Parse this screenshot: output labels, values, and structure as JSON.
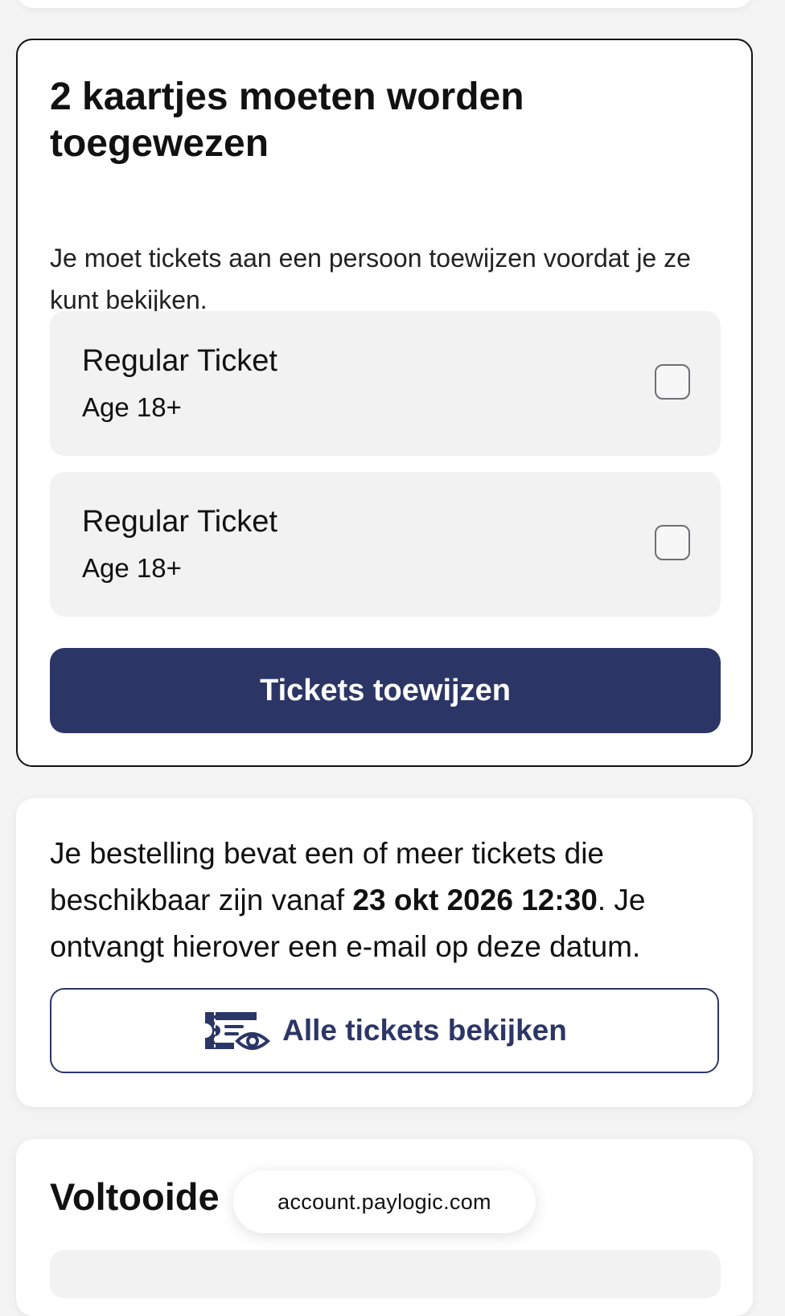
{
  "assign_card": {
    "title": "2 kaartjes moeten worden toegewezen",
    "description": "Je moet tickets aan een persoon toewijzen voordat je ze kunt bekijken.",
    "tickets": [
      {
        "name": "Regular Ticket",
        "age": "Age 18+",
        "checked": false
      },
      {
        "name": "Regular Ticket",
        "age": "Age 18+",
        "checked": false
      }
    ],
    "assign_button_label": "Tickets toewijzen"
  },
  "info_card": {
    "text_before": "Je bestelling bevat een of meer tickets die beschikbaar zijn vanaf ",
    "available_date": "23 okt 2026 12:30",
    "text_after": ". Je ontvangt hierover een e-mail op deze datum.",
    "view_button_label": "Alle tickets bekijken",
    "view_button_icon": "ticket-eye-icon"
  },
  "completed_card": {
    "title": "Voltooide"
  },
  "browser": {
    "url": "account.paylogic.com"
  },
  "colors": {
    "primary": "#2c3666",
    "row_background": "#f2f2f3",
    "page_background": "#f3f3f4"
  }
}
